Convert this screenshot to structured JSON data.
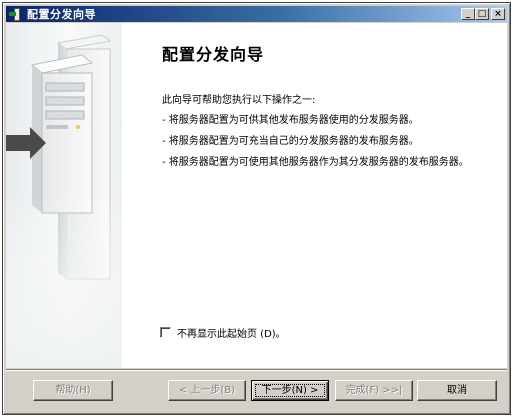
{
  "window": {
    "title": "配置分发向导",
    "minimize_glyph": "_",
    "maximize_glyph": "□",
    "close_glyph": "×"
  },
  "page": {
    "heading": "配置分发向导",
    "intro": "此向导可帮助您执行以下操作之一:",
    "bullets": [
      "- 将服务器配置为可供其他发布服务器使用的分发服务器。",
      "- 将服务器配置为可充当自己的分发服务器的发布服务器。",
      "- 将服务器配置为可使用其他服务器作为其分发服务器的发布服务器。"
    ],
    "checkbox_label": "不再显示此起始页 (D)。",
    "checkbox_checked": false
  },
  "buttons": {
    "help": "帮助(H)",
    "back": "< 上一步(B)",
    "next": "下一步(N) >",
    "finish": "完成(F) >>|",
    "cancel": "取消"
  }
}
